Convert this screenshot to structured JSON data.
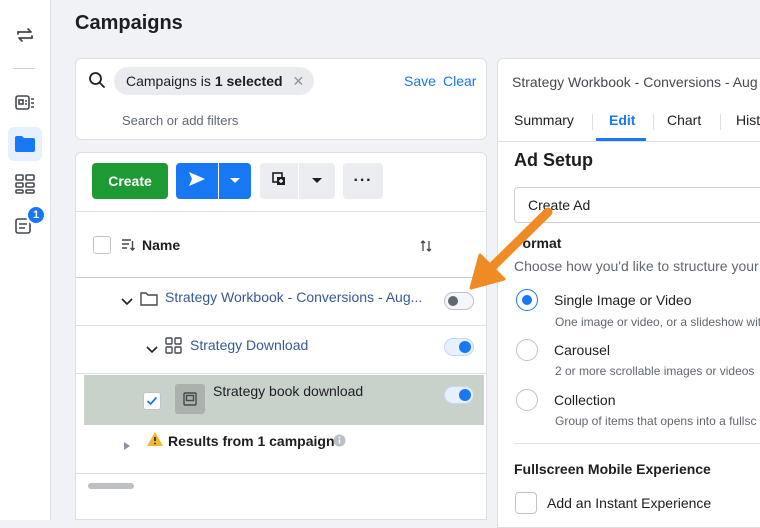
{
  "page": {
    "title": "Campaigns"
  },
  "rail": {
    "items": [
      {
        "icon": "switch-arrows-icon"
      },
      {
        "icon": "account-overview-icon"
      },
      {
        "icon": "campaigns-folder-icon",
        "active": true
      },
      {
        "icon": "grid-icon"
      },
      {
        "icon": "notifications-icon",
        "badge": "1"
      }
    ]
  },
  "filter": {
    "chip_prefix": "Campaigns is",
    "chip_value": "1 selected",
    "save_label": "Save",
    "clear_label": "Clear",
    "placeholder": "Search or add filters"
  },
  "toolbar": {
    "create_label": "Create"
  },
  "table": {
    "column_name": "Name",
    "rows": [
      {
        "label": "Strategy Workbook - Conversions - Aug...",
        "type": "campaign",
        "toggle": "off"
      },
      {
        "label": "Strategy Download",
        "type": "ad-set",
        "toggle": "on"
      },
      {
        "label": "Strategy book download",
        "type": "ad",
        "toggle": "on",
        "checked": true
      }
    ],
    "results_label": "Results from 1 campaign"
  },
  "editor": {
    "title": "Strategy Workbook - Conversions - Aug",
    "tabs": [
      "Summary",
      "Edit",
      "Chart",
      "Hist"
    ],
    "active_tab": "Edit",
    "ad_setup_title": "Ad Setup",
    "create_ad_value": "Create Ad",
    "format_title": "Format",
    "format_hint": "Choose how you'd like to structure your",
    "options": [
      {
        "label": "Single Image or Video",
        "desc": "One image or video, or a slideshow wit",
        "selected": true
      },
      {
        "label": "Carousel",
        "desc": "2 or more scrollable images or videos",
        "selected": false
      },
      {
        "label": "Collection",
        "desc": "Group of items that opens into a fullsc",
        "selected": false
      }
    ],
    "fullscreen_title": "Fullscreen Mobile Experience",
    "instant_experience_label": "Add an Instant Experience"
  },
  "colors": {
    "accent": "#1877f2",
    "create_green": "#1e9a35",
    "annotation_arrow": "#f08a24"
  }
}
